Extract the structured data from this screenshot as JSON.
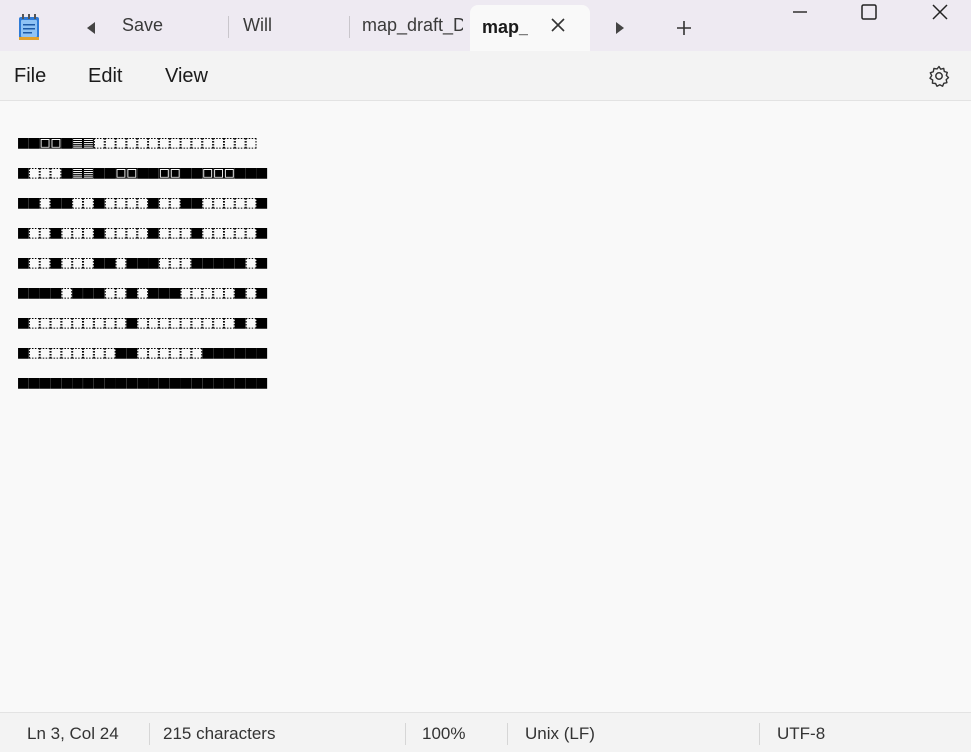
{
  "tabs": {
    "save_label": "Save",
    "tab_will": "Will",
    "tab_map_draft": "map_draft_D",
    "tab_active": "map_"
  },
  "icons": {
    "app": "notepad-icon",
    "scroll_left": "caret-left-icon",
    "scroll_right": "caret-right-icon",
    "close_tab": "close-icon",
    "new_tab": "plus-icon",
    "minimize": "minimize-icon",
    "maximize": "maximize-icon",
    "close_window": "close-icon",
    "settings": "gear-icon"
  },
  "menu": {
    "file": "File",
    "edit": "Edit",
    "view": "View"
  },
  "editor": {
    "lines": [
      "■■▣▣■▤▤⬚⬚⬚⬚⬚⬚⬚⬚⬚⬚⬚⬚⬚⬚⬚",
      "■⬚⬚⬚■▤▤■■▣▣■■▣▣■■▣▣▣■■■",
      "■■⬚■■⬚⬚■⬚⬚⬚⬚■⬚⬚■■⬚⬚⬚⬚⬚■",
      "■⬚⬚■⬚⬚⬚■⬚⬚⬚⬚■⬚⬚⬚■⬚⬚⬚⬚⬚■",
      "■⬚⬚■⬚⬚⬚■■⬚■■■⬚⬚⬚■■■■■⬚■",
      "■■■■⬚■■■⬚⬚■⬚■■■⬚⬚⬚⬚⬚■⬚■",
      "■⬚⬚⬚⬚⬚⬚⬚⬚⬚■⬚⬚⬚⬚⬚⬚⬚⬚⬚■⬚■",
      "■⬚⬚⬚⬚⬚⬚⬚⬚■■⬚⬚⬚⬚⬚⬚■■■■■■",
      "■■■■■■■■■■■■■■■■■■■■■■■"
    ]
  },
  "status": {
    "position": "Ln 3, Col 24",
    "characters": "215 characters",
    "zoom": "100%",
    "line_ending": "Unix (LF)",
    "encoding": "UTF-8"
  }
}
